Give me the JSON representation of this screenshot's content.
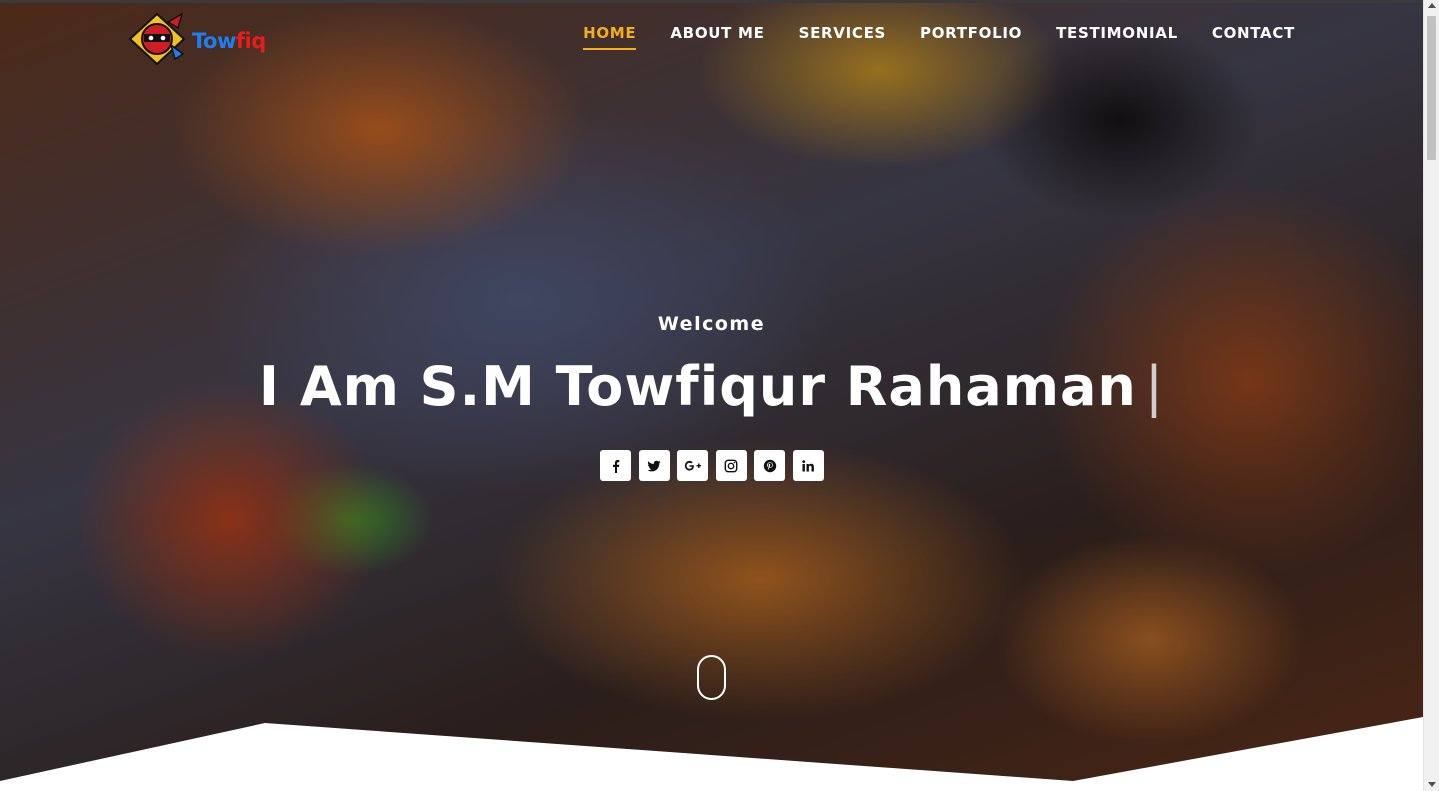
{
  "logo": {
    "text_part1": "Tow",
    "text_part2": "fiq",
    "icon": "ninja-mascot-icon"
  },
  "nav": {
    "items": [
      {
        "label": "HOME",
        "active": true
      },
      {
        "label": "ABOUT ME",
        "active": false
      },
      {
        "label": "SERVICES",
        "active": false
      },
      {
        "label": "PORTFOLIO",
        "active": false
      },
      {
        "label": "TESTIMONIAL",
        "active": false
      },
      {
        "label": "CONTACT",
        "active": false
      }
    ]
  },
  "hero": {
    "welcome": "Welcome",
    "headline": "I Am S.M Towfiqur Rahaman",
    "typing_cursor": "|",
    "socials": [
      {
        "icon": "facebook-icon"
      },
      {
        "icon": "twitter-icon"
      },
      {
        "icon": "google-plus-icon"
      },
      {
        "icon": "instagram-icon"
      },
      {
        "icon": "pinterest-icon"
      },
      {
        "icon": "linkedin-icon"
      }
    ],
    "scroll_indicator_icon": "mouse-scroll-icon"
  },
  "colors": {
    "accent": "#f6b017",
    "nav_text": "#ffffff",
    "logo_blue": "#1e7ef0",
    "logo_red": "#e81c1c"
  }
}
